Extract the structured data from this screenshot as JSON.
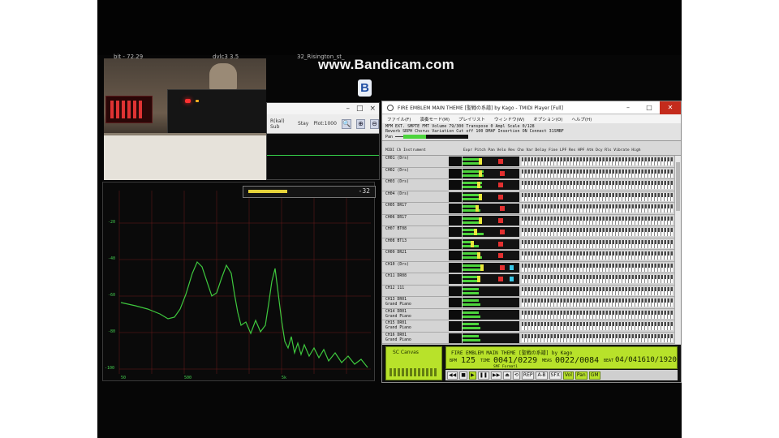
{
  "recorder": {
    "watermark": "www.Bandicam.com",
    "logo_letter": "B"
  },
  "desktop_captions": [
    "bit - 72.29",
    "dylc3 3.5",
    "32_Risington_st_"
  ],
  "small_window": {
    "minimize": "–",
    "maximize": "□",
    "close": "×",
    "labels": [
      "R(kal) Sub",
      "Stay",
      "Plot:1000"
    ],
    "icons": [
      "🔍",
      "⊕",
      "⊖"
    ]
  },
  "spectrum": {
    "peak_readout": "-32",
    "y_ticks": [
      "-20",
      "-40",
      "-60",
      "-80",
      "-100"
    ],
    "x_ticks": [
      "50",
      "500",
      "5k"
    ]
  },
  "tmidi": {
    "title": "FIRE EMBLEM MAIN THEME [聖戦の系譜] by Kago - TMIDI Player [Full]",
    "window_buttons": [
      "–",
      "□",
      "✕"
    ],
    "menus": [
      "ファイル(F)",
      "演奏モード(M)",
      "プレイリスト",
      "ウィンドウ(W)",
      "オプション(O)",
      "ヘルプ(H)"
    ],
    "info_lines": [
      "MFM EXT. SMPTE FMT  Volume 79/300  Transpose 0  Ampl Scale 0/128",
      "Reverb SRPH  Chorus        Variation  Cut off 100  DMAF  Insertion ON  Connect 31SMBF",
      "Pan  ━━━━━━━━━━  Stereo  FX Proc 1"
    ],
    "col_headers": [
      "MIDI Ch  Instrument",
      "Expr  Pitch  Pan  Velo  Rev  Cho  Var  Delay  Fine  LPF  Res  HPF  Atk  Dcy  Rls  Vibrate  High"
    ],
    "tracks": [
      {
        "ch": "CH01 (Drs)",
        "inst": ""
      },
      {
        "ch": "CH02 (Drs)",
        "inst": ""
      },
      {
        "ch": "CH03 (Drs)",
        "inst": ""
      },
      {
        "ch": "CH04 (Drs)",
        "inst": ""
      },
      {
        "ch": "CH05 DR17",
        "inst": ""
      },
      {
        "ch": "CH06 DR17",
        "inst": ""
      },
      {
        "ch": "CH07 BT08",
        "inst": ""
      },
      {
        "ch": "CH08 BT13",
        "inst": ""
      },
      {
        "ch": "CH09 DR21",
        "inst": ""
      },
      {
        "ch": "CH10 (Drs)",
        "inst": ""
      },
      {
        "ch": "CH11 DR08",
        "inst": ""
      },
      {
        "ch": "CH12 111",
        "inst": ""
      },
      {
        "ch": "CH13 DR01",
        "inst": "Grand Piano"
      },
      {
        "ch": "CH14 DR01",
        "inst": "Grand Piano"
      },
      {
        "ch": "CH15 DR01",
        "inst": "Grand Piano"
      },
      {
        "ch": "CH16 DR01",
        "inst": "Grand Piano"
      }
    ],
    "canvas_label": "SC Canvas",
    "lcd": {
      "title": "FIRE EMBLEM MAIN THEME [聖戦の系譜] by Kago",
      "tempo_label": "BPM",
      "tempo": "125",
      "time_label": "TIME",
      "time": "0041/0229",
      "measure_label": "MEAS",
      "measure": "0022/0084",
      "beat_label": "BEAT",
      "beat": "04/041610/1920",
      "format": "SMF Format1"
    },
    "transport": [
      "◀◀",
      "■",
      "▶",
      "❚❚",
      "▶▶",
      "⏏",
      "⟲",
      "REP",
      "A-B",
      "SFX",
      "Vol",
      "Pan",
      "GM"
    ]
  }
}
